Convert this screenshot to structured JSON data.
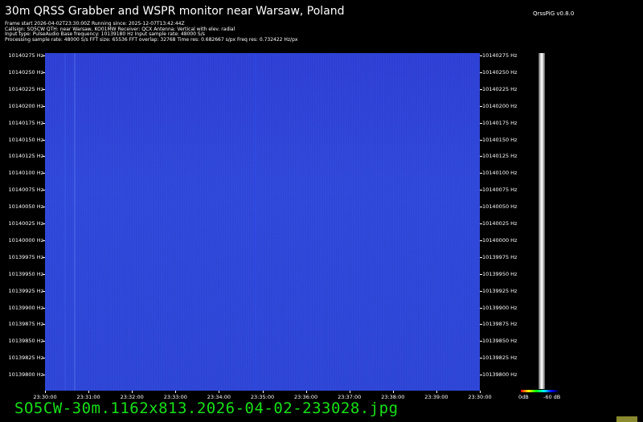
{
  "header": {
    "title": "30m QRSS Grabber and WSPR monitor near Warsaw, Poland",
    "version": "QrssPiG v0.8.0",
    "info_lines": [
      "Frame start 2026-04-02T23:30:00Z Running since: 2025-12-07T13:42:44Z",
      "Callsign: SO5CW QTH: near Warsaw, KO01MW Receiver: QCX Antenna: Vertical with elev. radial",
      "Input type: PulseAudio Base frequency: 10139180 Hz Input sample rate: 48000 S/s",
      "Processing sample rate: 48000 S/s FFT size: 65536 FFT overlap: 32768 Time res: 0.682667 s/px Freq res: 0.732422 Hz/px"
    ]
  },
  "chart_data": {
    "type": "heatmap",
    "y_ticks": [
      "10140275 Hz",
      "10140250 Hz",
      "10140225 Hz",
      "10140200 Hz",
      "10140175 Hz",
      "10140150 Hz",
      "10140125 Hz",
      "10140100 Hz",
      "10140075 Hz",
      "10140050 Hz",
      "10140025 Hz",
      "10140000 Hz",
      "10139975 Hz",
      "10139950 Hz",
      "10139925 Hz",
      "10139900 Hz",
      "10139875 Hz",
      "10139850 Hz",
      "10139825 Hz",
      "10139800 Hz"
    ],
    "x_ticks": [
      "23:30:00",
      "23:31:00",
      "23:32:00",
      "23:33:00",
      "23:34:00",
      "23:35:00",
      "23:36:00",
      "23:37:00",
      "23:38:00",
      "23:39:00",
      "23:30:00"
    ],
    "colorscale": [
      "0dB",
      "-60 dB"
    ],
    "colors": {
      "background": "#2d48e6",
      "footer": "#17e017"
    }
  },
  "footer": {
    "filename": "SO5CW-30m.1162x813.2026-04-02-233028.jpg"
  }
}
